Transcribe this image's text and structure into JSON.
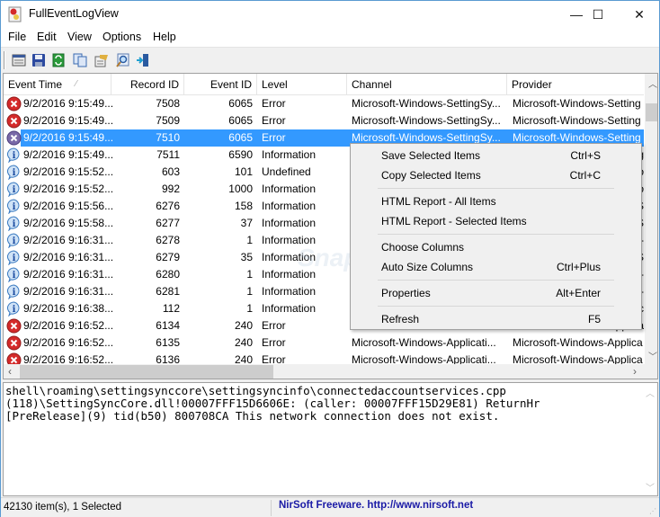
{
  "window": {
    "title": "FullEventLogView",
    "controls": {
      "minimize": "—",
      "maximize": "☐",
      "close": "✕"
    }
  },
  "menu": [
    "File",
    "Edit",
    "View",
    "Options",
    "Help"
  ],
  "toolbar": {
    "icons": [
      "properties-window-icon",
      "save-icon",
      "refresh-icon",
      "copy-icon",
      "html-report-icon",
      "find-icon",
      "exit-icon"
    ]
  },
  "columns": [
    "Event Time",
    "Record ID",
    "Event ID",
    "Level",
    "Channel",
    "Provider"
  ],
  "sort_indicator": "⁄",
  "rows": [
    {
      "icon": "error",
      "time": "9/2/2016 9:15:49...",
      "record": "7508",
      "event": "6065",
      "level": "Error",
      "channel": "Microsoft-Windows-SettingSy...",
      "provider": "Microsoft-Windows-Setting"
    },
    {
      "icon": "error",
      "time": "9/2/2016 9:15:49...",
      "record": "7509",
      "event": "6065",
      "level": "Error",
      "channel": "Microsoft-Windows-SettingSy...",
      "provider": "Microsoft-Windows-Setting"
    },
    {
      "icon": "error-selected",
      "time": "9/2/2016 9:15:49...",
      "record": "7510",
      "event": "6065",
      "level": "Error",
      "channel": "Microsoft-Windows-SettingSy...",
      "provider": "Microsoft-Windows-Setting",
      "selected": true
    },
    {
      "icon": "info",
      "time": "9/2/2016 9:15:49...",
      "record": "7511",
      "event": "6590",
      "level": "Information",
      "channel": "",
      "provider": "etting"
    },
    {
      "icon": "info",
      "time": "9/2/2016 9:15:52...",
      "record": "603",
      "event": "101",
      "level": "Undefined",
      "channel": "",
      "provider": "Windo"
    },
    {
      "icon": "info",
      "time": "9/2/2016 9:15:52...",
      "record": "992",
      "event": "1000",
      "level": "Information",
      "channel": "",
      "provider": "Windo"
    },
    {
      "icon": "info",
      "time": "9/2/2016 9:15:56...",
      "record": "6276",
      "event": "158",
      "level": "Information",
      "channel": "",
      "provider": "ime-S"
    },
    {
      "icon": "info",
      "time": "9/2/2016 9:15:58...",
      "record": "6277",
      "event": "37",
      "level": "Information",
      "channel": "",
      "provider": "ime-S"
    },
    {
      "icon": "info",
      "time": "9/2/2016 9:16:31...",
      "record": "6278",
      "event": "1",
      "level": "Information",
      "channel": "",
      "provider": "ernel-"
    },
    {
      "icon": "info",
      "time": "9/2/2016 9:16:31...",
      "record": "6279",
      "event": "35",
      "level": "Information",
      "channel": "",
      "provider": "ime-S"
    },
    {
      "icon": "info",
      "time": "9/2/2016 9:16:31...",
      "record": "6280",
      "event": "1",
      "level": "Information",
      "channel": "",
      "provider": "ernel-"
    },
    {
      "icon": "info",
      "time": "9/2/2016 9:16:31...",
      "record": "6281",
      "event": "1",
      "level": "Information",
      "channel": "",
      "provider": "ernel-"
    },
    {
      "icon": "info",
      "time": "9/2/2016 9:16:38...",
      "record": "112",
      "event": "1",
      "level": "Information",
      "channel": "",
      "provider": "ZSync"
    },
    {
      "icon": "error",
      "time": "9/2/2016 9:16:52...",
      "record": "6134",
      "event": "240",
      "level": "Error",
      "channel": "",
      "provider": "pplica"
    },
    {
      "icon": "error",
      "time": "9/2/2016 9:16:52...",
      "record": "6135",
      "event": "240",
      "level": "Error",
      "channel": "Microsoft-Windows-Applicati...",
      "provider": "Microsoft-Windows-Applica"
    },
    {
      "icon": "error",
      "time": "9/2/2016 9:16:52...",
      "record": "6136",
      "event": "240",
      "level": "Error",
      "channel": "Microsoft-Windows-Applicati...",
      "provider": "Microsoft-Windows-Applica"
    }
  ],
  "context_menu": [
    {
      "label": "Save Selected Items",
      "shortcut": "Ctrl+S"
    },
    {
      "label": "Copy Selected Items",
      "shortcut": "Ctrl+C"
    },
    {
      "separator": true
    },
    {
      "label": "HTML Report - All Items",
      "shortcut": ""
    },
    {
      "label": "HTML Report - Selected Items",
      "shortcut": ""
    },
    {
      "separator": true
    },
    {
      "label": "Choose Columns",
      "shortcut": ""
    },
    {
      "label": "Auto Size Columns",
      "shortcut": "Ctrl+Plus"
    },
    {
      "separator": true
    },
    {
      "label": "Properties",
      "shortcut": "Alt+Enter"
    },
    {
      "separator": true
    },
    {
      "label": "Refresh",
      "shortcut": "F5"
    }
  ],
  "detail": {
    "text": "shell\\roaming\\settingsynccore\\settingsyncinfo\\connectedaccountservices.cpp\n(118)\\SettingSyncCore.dll!00007FFF15D6606E: (caller: 00007FFF15D29E81) ReturnHr\n[PreRelease](9) tid(b50) 800708CA This network connection does not exist."
  },
  "status": {
    "items": "42130 item(s), 1 Selected",
    "link": "NirSoft Freeware.  http://www.nirsoft.net"
  },
  "watermark": "SnapFiles",
  "colors": {
    "selection": "#3399ff",
    "link": "#1a1aa6",
    "error": "#d42a2a"
  }
}
